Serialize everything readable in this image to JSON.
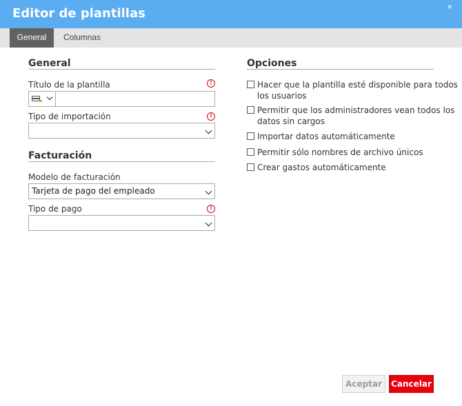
{
  "window": {
    "title": "Editor de plantillas",
    "close_glyph": "×"
  },
  "tabs": [
    {
      "label": "General",
      "active": true
    },
    {
      "label": "Columnas",
      "active": false
    }
  ],
  "general": {
    "heading": "General",
    "title_label": "Título de la plantilla",
    "title_value": "",
    "import_type_label": "Tipo de importación",
    "import_type_value": ""
  },
  "billing": {
    "heading": "Facturación",
    "model_label": "Modelo de facturación",
    "model_value": "Tarjeta de pago del empleado",
    "payment_type_label": "Tipo de pago",
    "payment_type_value": ""
  },
  "options": {
    "heading": "Opciones",
    "items": [
      {
        "label": "Hacer que la plantilla esté disponible para todos los usuarios",
        "checked": false
      },
      {
        "label": "Permitir que los administradores vean todos los datos sin cargos",
        "checked": false
      },
      {
        "label": "Importar datos automáticamente",
        "checked": false
      },
      {
        "label": "Permitir sólo nombres de archivo únicos",
        "checked": false
      },
      {
        "label": "Crear gastos automáticamente",
        "checked": false
      }
    ]
  },
  "buttons": {
    "accept": "Aceptar",
    "cancel": "Cancelar"
  },
  "required_glyph": "!",
  "colors": {
    "titlebar": "#5aadf0",
    "tab_active": "#626262",
    "cancel": "#e8000d",
    "required": "#d0021b"
  }
}
